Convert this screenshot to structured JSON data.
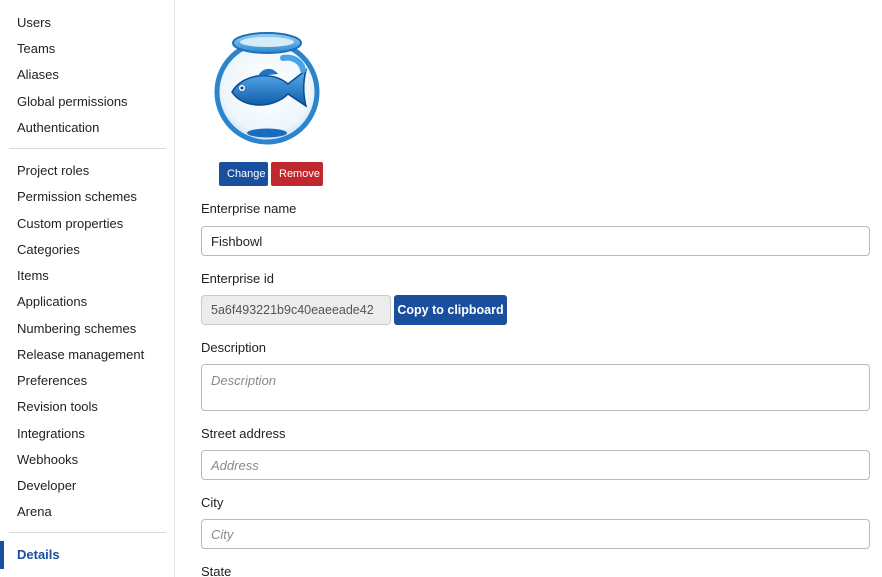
{
  "sidebar": {
    "group1": [
      "Users",
      "Teams",
      "Aliases",
      "Global permissions",
      "Authentication"
    ],
    "group2": [
      "Project roles",
      "Permission schemes",
      "Custom properties",
      "Categories",
      "Items",
      "Applications",
      "Numbering schemes",
      "Release management",
      "Preferences",
      "Revision tools",
      "Integrations",
      "Webhooks",
      "Developer",
      "Arena"
    ],
    "active": "Details"
  },
  "logo": {
    "icon": "fishbowl-icon"
  },
  "buttons": {
    "change": "Change",
    "remove": "Remove",
    "copy": "Copy to clipboard"
  },
  "form": {
    "enterprise_name": {
      "label": "Enterprise name",
      "value": "Fishbowl"
    },
    "enterprise_id": {
      "label": "Enterprise id",
      "value": "5a6f493221b9c40eaeeade42"
    },
    "description": {
      "label": "Description",
      "placeholder": "Description"
    },
    "street_address": {
      "label": "Street address",
      "placeholder": "Address"
    },
    "city": {
      "label": "City",
      "placeholder": "City"
    },
    "state": {
      "label": "State"
    }
  },
  "colors": {
    "primary": "#1a4fa0",
    "danger": "#c0282f"
  }
}
